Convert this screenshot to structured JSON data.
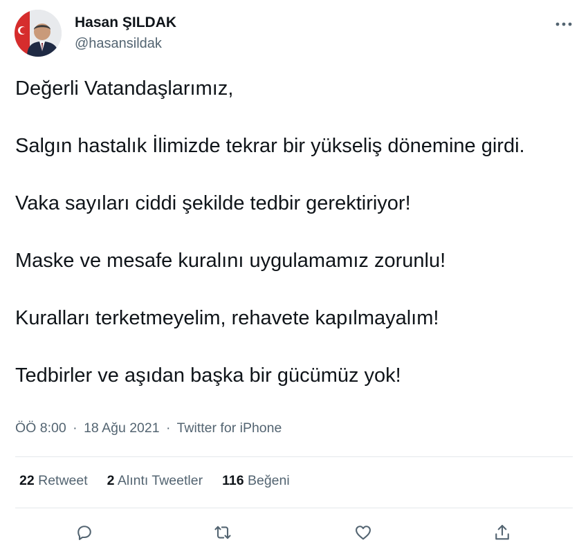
{
  "author": {
    "name": "Hasan ŞILDAK",
    "handle": "@hasansildak"
  },
  "tweet_text": [
    "Değerli Vatandaşlarımız,",
    "Salgın hastalık İlimizde tekrar bir yükseliş dönemine girdi.",
    "Vaka sayıları ciddi şekilde tedbir gerektiriyor!",
    "Maske ve mesafe kuralını uygulamamız zorunlu!",
    "Kuralları terketmeyelim, rehavete kapılmayalım!",
    "Tedbirler ve aşıdan başka bir gücümüz yok!"
  ],
  "meta": {
    "time": "ÖÖ 8:00",
    "separator": "·",
    "date": "18 Ağu 2021",
    "source": "Twitter for iPhone"
  },
  "stats": {
    "retweets_count": "22",
    "retweets_label": "Retweet",
    "quotes_count": "2",
    "quotes_label": "Alıntı Tweetler",
    "likes_count": "116",
    "likes_label": "Beğeni"
  },
  "icons": {
    "more": "more-horizontal-icon",
    "reply": "reply-icon",
    "retweet": "retweet-icon",
    "like": "heart-icon",
    "share": "share-icon"
  },
  "colors": {
    "text": "#0f1419",
    "secondary": "#536471",
    "divider": "#e4e8eb"
  }
}
